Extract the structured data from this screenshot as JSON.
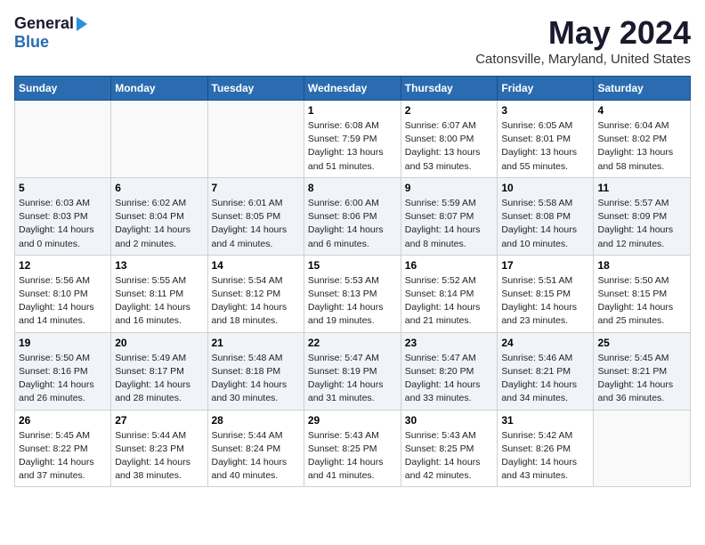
{
  "logo": {
    "general": "General",
    "blue": "Blue"
  },
  "title": {
    "month_year": "May 2024",
    "location": "Catonsville, Maryland, United States"
  },
  "headers": [
    "Sunday",
    "Monday",
    "Tuesday",
    "Wednesday",
    "Thursday",
    "Friday",
    "Saturday"
  ],
  "weeks": [
    [
      {
        "day": "",
        "sunrise": "",
        "sunset": "",
        "daylight": ""
      },
      {
        "day": "",
        "sunrise": "",
        "sunset": "",
        "daylight": ""
      },
      {
        "day": "",
        "sunrise": "",
        "sunset": "",
        "daylight": ""
      },
      {
        "day": "1",
        "sunrise": "Sunrise: 6:08 AM",
        "sunset": "Sunset: 7:59 PM",
        "daylight": "Daylight: 13 hours and 51 minutes."
      },
      {
        "day": "2",
        "sunrise": "Sunrise: 6:07 AM",
        "sunset": "Sunset: 8:00 PM",
        "daylight": "Daylight: 13 hours and 53 minutes."
      },
      {
        "day": "3",
        "sunrise": "Sunrise: 6:05 AM",
        "sunset": "Sunset: 8:01 PM",
        "daylight": "Daylight: 13 hours and 55 minutes."
      },
      {
        "day": "4",
        "sunrise": "Sunrise: 6:04 AM",
        "sunset": "Sunset: 8:02 PM",
        "daylight": "Daylight: 13 hours and 58 minutes."
      }
    ],
    [
      {
        "day": "5",
        "sunrise": "Sunrise: 6:03 AM",
        "sunset": "Sunset: 8:03 PM",
        "daylight": "Daylight: 14 hours and 0 minutes."
      },
      {
        "day": "6",
        "sunrise": "Sunrise: 6:02 AM",
        "sunset": "Sunset: 8:04 PM",
        "daylight": "Daylight: 14 hours and 2 minutes."
      },
      {
        "day": "7",
        "sunrise": "Sunrise: 6:01 AM",
        "sunset": "Sunset: 8:05 PM",
        "daylight": "Daylight: 14 hours and 4 minutes."
      },
      {
        "day": "8",
        "sunrise": "Sunrise: 6:00 AM",
        "sunset": "Sunset: 8:06 PM",
        "daylight": "Daylight: 14 hours and 6 minutes."
      },
      {
        "day": "9",
        "sunrise": "Sunrise: 5:59 AM",
        "sunset": "Sunset: 8:07 PM",
        "daylight": "Daylight: 14 hours and 8 minutes."
      },
      {
        "day": "10",
        "sunrise": "Sunrise: 5:58 AM",
        "sunset": "Sunset: 8:08 PM",
        "daylight": "Daylight: 14 hours and 10 minutes."
      },
      {
        "day": "11",
        "sunrise": "Sunrise: 5:57 AM",
        "sunset": "Sunset: 8:09 PM",
        "daylight": "Daylight: 14 hours and 12 minutes."
      }
    ],
    [
      {
        "day": "12",
        "sunrise": "Sunrise: 5:56 AM",
        "sunset": "Sunset: 8:10 PM",
        "daylight": "Daylight: 14 hours and 14 minutes."
      },
      {
        "day": "13",
        "sunrise": "Sunrise: 5:55 AM",
        "sunset": "Sunset: 8:11 PM",
        "daylight": "Daylight: 14 hours and 16 minutes."
      },
      {
        "day": "14",
        "sunrise": "Sunrise: 5:54 AM",
        "sunset": "Sunset: 8:12 PM",
        "daylight": "Daylight: 14 hours and 18 minutes."
      },
      {
        "day": "15",
        "sunrise": "Sunrise: 5:53 AM",
        "sunset": "Sunset: 8:13 PM",
        "daylight": "Daylight: 14 hours and 19 minutes."
      },
      {
        "day": "16",
        "sunrise": "Sunrise: 5:52 AM",
        "sunset": "Sunset: 8:14 PM",
        "daylight": "Daylight: 14 hours and 21 minutes."
      },
      {
        "day": "17",
        "sunrise": "Sunrise: 5:51 AM",
        "sunset": "Sunset: 8:15 PM",
        "daylight": "Daylight: 14 hours and 23 minutes."
      },
      {
        "day": "18",
        "sunrise": "Sunrise: 5:50 AM",
        "sunset": "Sunset: 8:15 PM",
        "daylight": "Daylight: 14 hours and 25 minutes."
      }
    ],
    [
      {
        "day": "19",
        "sunrise": "Sunrise: 5:50 AM",
        "sunset": "Sunset: 8:16 PM",
        "daylight": "Daylight: 14 hours and 26 minutes."
      },
      {
        "day": "20",
        "sunrise": "Sunrise: 5:49 AM",
        "sunset": "Sunset: 8:17 PM",
        "daylight": "Daylight: 14 hours and 28 minutes."
      },
      {
        "day": "21",
        "sunrise": "Sunrise: 5:48 AM",
        "sunset": "Sunset: 8:18 PM",
        "daylight": "Daylight: 14 hours and 30 minutes."
      },
      {
        "day": "22",
        "sunrise": "Sunrise: 5:47 AM",
        "sunset": "Sunset: 8:19 PM",
        "daylight": "Daylight: 14 hours and 31 minutes."
      },
      {
        "day": "23",
        "sunrise": "Sunrise: 5:47 AM",
        "sunset": "Sunset: 8:20 PM",
        "daylight": "Daylight: 14 hours and 33 minutes."
      },
      {
        "day": "24",
        "sunrise": "Sunrise: 5:46 AM",
        "sunset": "Sunset: 8:21 PM",
        "daylight": "Daylight: 14 hours and 34 minutes."
      },
      {
        "day": "25",
        "sunrise": "Sunrise: 5:45 AM",
        "sunset": "Sunset: 8:21 PM",
        "daylight": "Daylight: 14 hours and 36 minutes."
      }
    ],
    [
      {
        "day": "26",
        "sunrise": "Sunrise: 5:45 AM",
        "sunset": "Sunset: 8:22 PM",
        "daylight": "Daylight: 14 hours and 37 minutes."
      },
      {
        "day": "27",
        "sunrise": "Sunrise: 5:44 AM",
        "sunset": "Sunset: 8:23 PM",
        "daylight": "Daylight: 14 hours and 38 minutes."
      },
      {
        "day": "28",
        "sunrise": "Sunrise: 5:44 AM",
        "sunset": "Sunset: 8:24 PM",
        "daylight": "Daylight: 14 hours and 40 minutes."
      },
      {
        "day": "29",
        "sunrise": "Sunrise: 5:43 AM",
        "sunset": "Sunset: 8:25 PM",
        "daylight": "Daylight: 14 hours and 41 minutes."
      },
      {
        "day": "30",
        "sunrise": "Sunrise: 5:43 AM",
        "sunset": "Sunset: 8:25 PM",
        "daylight": "Daylight: 14 hours and 42 minutes."
      },
      {
        "day": "31",
        "sunrise": "Sunrise: 5:42 AM",
        "sunset": "Sunset: 8:26 PM",
        "daylight": "Daylight: 14 hours and 43 minutes."
      },
      {
        "day": "",
        "sunrise": "",
        "sunset": "",
        "daylight": ""
      }
    ]
  ]
}
